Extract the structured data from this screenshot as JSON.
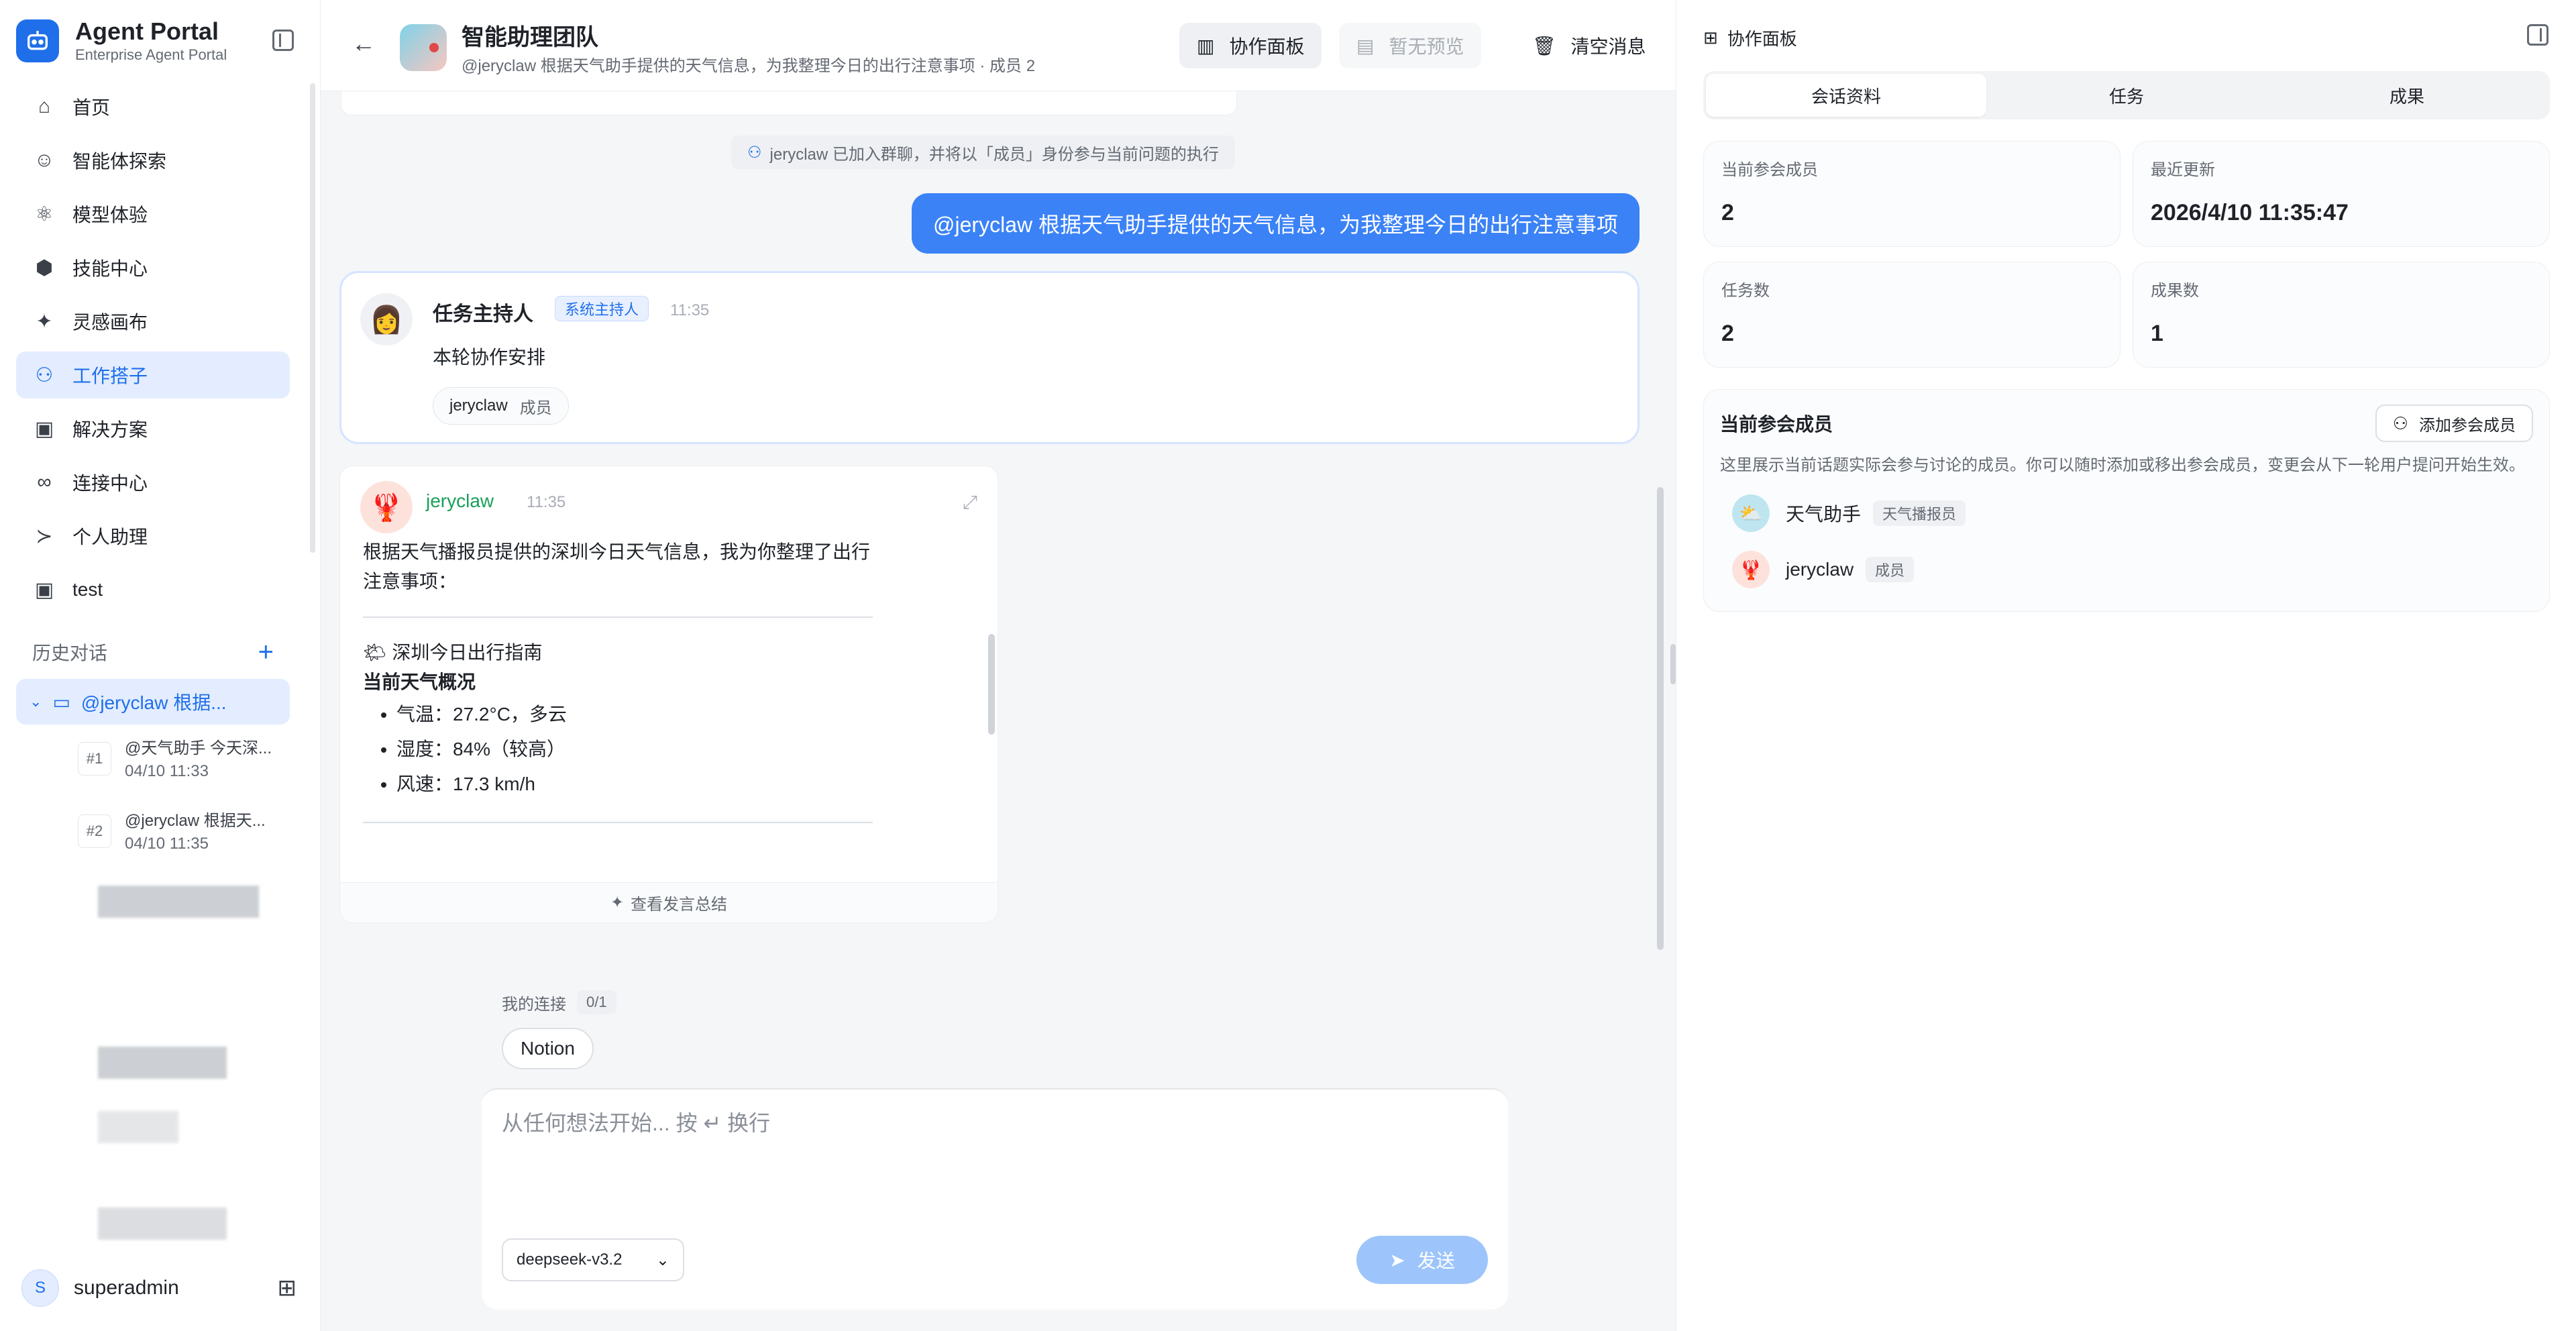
{
  "brand": {
    "title": "Agent Portal",
    "subtitle": "Enterprise Agent Portal"
  },
  "nav": [
    {
      "label": "首页",
      "icon": "home-icon",
      "glyph": "⌂"
    },
    {
      "label": "智能体探索",
      "icon": "robot-icon",
      "glyph": "☺"
    },
    {
      "label": "模型体验",
      "icon": "atom-icon",
      "glyph": "⚛"
    },
    {
      "label": "技能中心",
      "icon": "cube-icon",
      "glyph": "⬢"
    },
    {
      "label": "灵感画布",
      "icon": "sparkle-icon",
      "glyph": "✦"
    },
    {
      "label": "工作搭子",
      "icon": "users-icon",
      "glyph": "⚇",
      "active": true
    },
    {
      "label": "解决方案",
      "icon": "briefcase-icon",
      "glyph": "▣"
    },
    {
      "label": "连接中心",
      "icon": "link-icon",
      "glyph": "∞"
    },
    {
      "label": "个人助理",
      "icon": "terminal-icon",
      "glyph": "≻"
    },
    {
      "label": "test",
      "icon": "briefcase-icon",
      "glyph": "▣"
    }
  ],
  "history": {
    "title": "历史对话",
    "active": "@jeryclaw 根据...",
    "items": [
      {
        "num": "#1",
        "title": "@天气助手 今天深...",
        "time": "04/10 11:33"
      },
      {
        "num": "#2",
        "title": "@jeryclaw 根据天...",
        "time": "04/10 11:35"
      }
    ]
  },
  "user": {
    "initial": "S",
    "name": "superadmin"
  },
  "header": {
    "title": "智能助理团队",
    "subtitle": "@jeryclaw 根据天气助手提供的天气信息，为我整理今日的出行注意事项 · 成员 2",
    "board": "协作面板",
    "preview": "暂无预览",
    "clear": "清空消息"
  },
  "chat": {
    "system_notice": "jeryclaw 已加入群聊，并将以「成员」身份参与当前问题的执行",
    "user_message": "@jeryclaw 根据天气助手提供的天气信息，为我整理今日的出行注意事项",
    "host": {
      "name": "任务主持人",
      "tag": "系统主持人",
      "time": "11:35",
      "body": "本轮协作安排",
      "chip_name": "jeryclaw",
      "chip_role": "成员"
    },
    "reply": {
      "name": "jeryclaw",
      "time": "11:35",
      "intro": "根据天气播报员提供的深圳今日天气信息，我为你整理了出行注意事项：",
      "guide_title": "🌤 深圳今日出行指南",
      "section": "当前天气概况",
      "bullets": [
        "气温：27.2°C，多云",
        "湿度：84%（较高）",
        "风速：17.3 km/h"
      ],
      "footer": "查看发言总结"
    },
    "connections_label": "我的连接",
    "connections_count": "0/1",
    "connection_chip": "Notion",
    "input_placeholder": "从任何想法开始... 按 ↵ 换行",
    "model": "deepseek-v3.2",
    "send": "发送"
  },
  "panel": {
    "title": "协作面板",
    "tabs": [
      "会话资料",
      "任务",
      "成果"
    ],
    "stats": [
      {
        "label": "当前参会成员",
        "value": "2"
      },
      {
        "label": "最近更新",
        "value": "2026/4/10 11:35:47"
      },
      {
        "label": "任务数",
        "value": "2"
      },
      {
        "label": "成果数",
        "value": "1"
      }
    ],
    "members_title": "当前参会成员",
    "add_member": "添加参会成员",
    "members_desc": "这里展示当前话题实际会参与讨论的成员。你可以随时添加或移出参会成员，变更会从下一轮用户提问开始生效。",
    "members": [
      {
        "name": "天气助手",
        "role": "天气播报员"
      },
      {
        "name": "jeryclaw",
        "role": "成员"
      }
    ]
  },
  "colors": {
    "accent": "#1f6feb",
    "user_bubble": "#3b82f6",
    "reply_name": "#18a058"
  }
}
